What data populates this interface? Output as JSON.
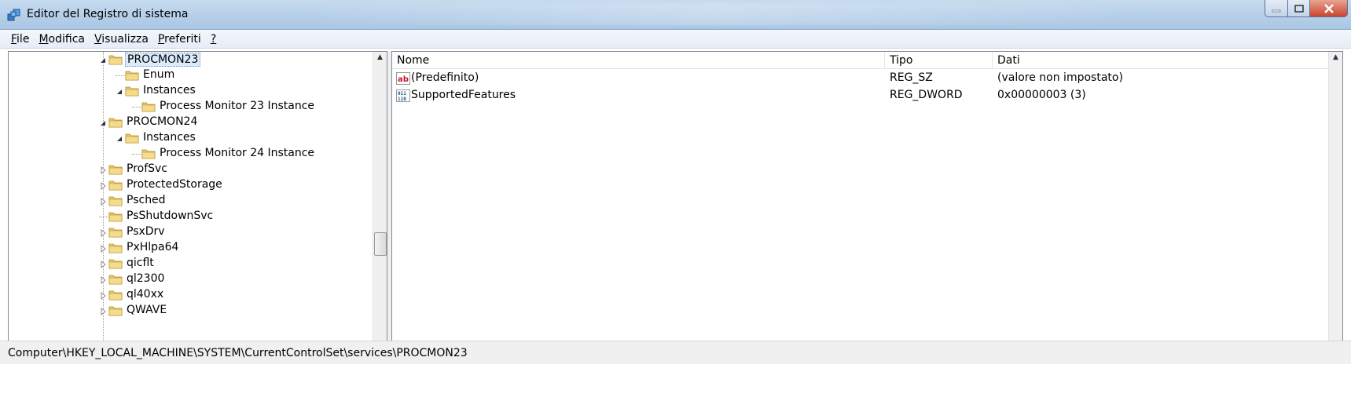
{
  "window": {
    "title": "Editor del Registro di sistema"
  },
  "menu": [
    {
      "label": "File",
      "accel": "F"
    },
    {
      "label": "Modifica",
      "accel": "M"
    },
    {
      "label": "Visualizza",
      "accel": "V"
    },
    {
      "label": "Preferiti",
      "accel": "P"
    },
    {
      "label": "?",
      "accel": "?"
    }
  ],
  "tree": {
    "items": [
      {
        "label": "PROCMON23",
        "level": 0,
        "expander": "expanded",
        "selected": true
      },
      {
        "label": "Enum",
        "level": 1,
        "expander": "none"
      },
      {
        "label": "Instances",
        "level": 1,
        "expander": "expanded"
      },
      {
        "label": "Process Monitor 23 Instance",
        "level": 2,
        "expander": "none"
      },
      {
        "label": "PROCMON24",
        "level": 0,
        "expander": "expanded"
      },
      {
        "label": "Instances",
        "level": 1,
        "expander": "expanded"
      },
      {
        "label": "Process Monitor 24 Instance",
        "level": 2,
        "expander": "none"
      },
      {
        "label": "ProfSvc",
        "level": 0,
        "expander": "collapsed"
      },
      {
        "label": "ProtectedStorage",
        "level": 0,
        "expander": "collapsed"
      },
      {
        "label": "Psched",
        "level": 0,
        "expander": "collapsed"
      },
      {
        "label": "PsShutdownSvc",
        "level": 0,
        "expander": "none"
      },
      {
        "label": "PsxDrv",
        "level": 0,
        "expander": "collapsed"
      },
      {
        "label": "PxHlpa64",
        "level": 0,
        "expander": "collapsed"
      },
      {
        "label": "qicflt",
        "level": 0,
        "expander": "collapsed"
      },
      {
        "label": "ql2300",
        "level": 0,
        "expander": "collapsed"
      },
      {
        "label": "ql40xx",
        "level": 0,
        "expander": "collapsed"
      },
      {
        "label": "QWAVE",
        "level": 0,
        "expander": "collapsed"
      }
    ]
  },
  "list": {
    "columns": [
      "Nome",
      "Tipo",
      "Dati"
    ],
    "rows": [
      {
        "icon": "string-value-icon",
        "name": "(Predefinito)",
        "type": "REG_SZ",
        "data": "(valore non impostato)"
      },
      {
        "icon": "binary-value-icon",
        "name": "SupportedFeatures",
        "type": "REG_DWORD",
        "data": "0x00000003 (3)"
      }
    ]
  },
  "status": {
    "path": "Computer\\HKEY_LOCAL_MACHINE\\SYSTEM\\CurrentControlSet\\services\\PROCMON23"
  },
  "colors": {
    "selection": "#dcebfc",
    "folder": "#e8c86a",
    "titlebar": "#b9d1ea"
  }
}
